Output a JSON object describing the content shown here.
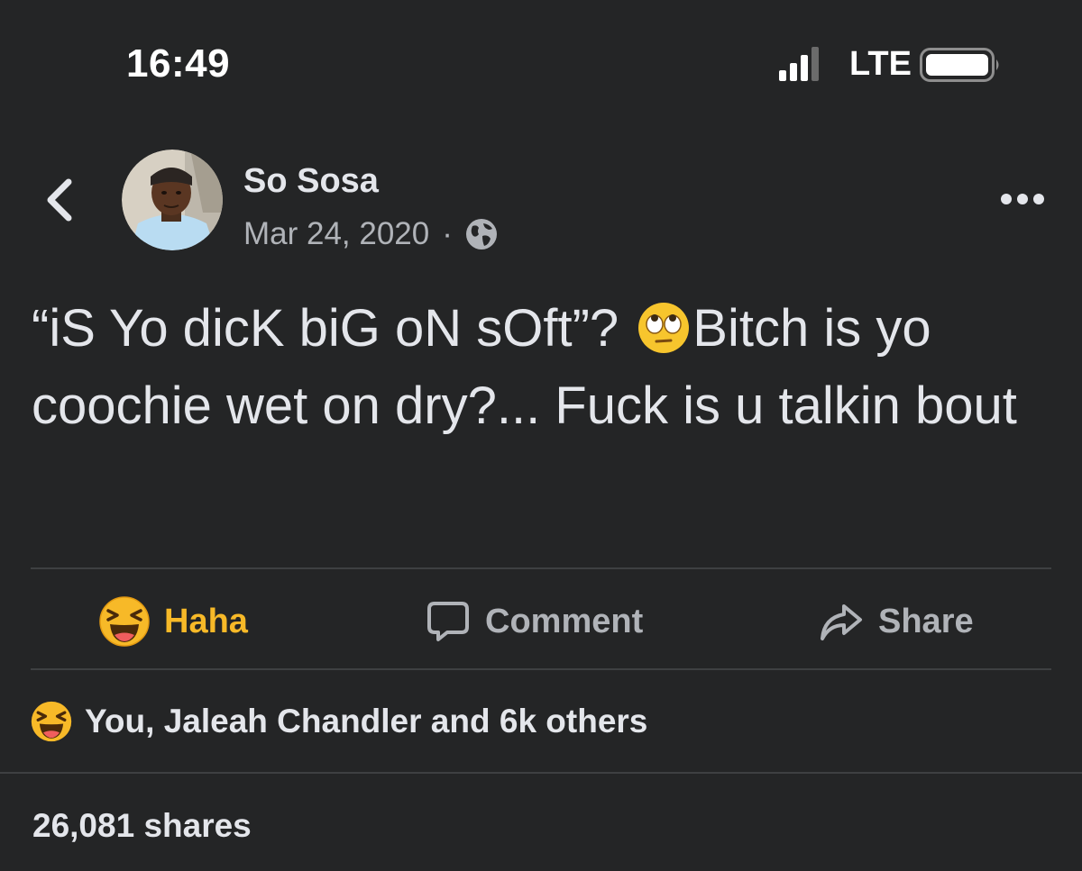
{
  "status_bar": {
    "time": "16:49",
    "network": "LTE"
  },
  "post": {
    "author": "So Sosa",
    "date": "Mar 24, 2020",
    "separator": "·",
    "text_before_emoji": "“iS Yo dicK biG oN sOft”?",
    "text_after_emoji": "Bitch is yo coochie wet on dry?... Fuck is u talkin bout",
    "inline_emoji": "face-with-rolling-eyes"
  },
  "actions": {
    "haha_label": "Haha",
    "comment_label": "Comment",
    "share_label": "Share"
  },
  "reactions": {
    "summary": "You, Jaleah Chandler and 6k others"
  },
  "shares": {
    "count_text": "26,081 shares"
  },
  "colors": {
    "background": "#242526",
    "primary_text": "#e4e6eb",
    "secondary_text": "#b0b3b8",
    "haha_accent": "#f7b928",
    "divider": "#3e4042"
  }
}
